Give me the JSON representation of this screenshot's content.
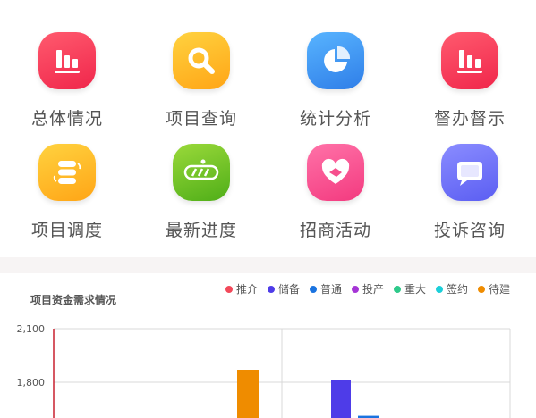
{
  "menu": {
    "items": [
      {
        "label": "总体情况",
        "icon": "bar-chart-icon",
        "color_from": "#ff5a6e",
        "color_to": "#f0264b"
      },
      {
        "label": "项目查询",
        "icon": "search-icon",
        "color_from": "#ffd23f",
        "color_to": "#ffa516"
      },
      {
        "label": "统计分析",
        "icon": "pie-chart-icon",
        "color_from": "#58b4ff",
        "color_to": "#2f7ee8"
      },
      {
        "label": "督办督示",
        "icon": "bar-chart-icon",
        "color_from": "#ff5a6e",
        "color_to": "#f0264b"
      },
      {
        "label": "项目调度",
        "icon": "server-sync-icon",
        "color_from": "#ffd23f",
        "color_to": "#ffa516"
      },
      {
        "label": "最新进度",
        "icon": "progress-bar-icon",
        "color_from": "#9ad93a",
        "color_to": "#4fae18"
      },
      {
        "label": "招商活动",
        "icon": "handshake-heart-icon",
        "color_from": "#ff72a8",
        "color_to": "#f33a7f"
      },
      {
        "label": "投诉咨询",
        "icon": "chat-bubble-icon",
        "color_from": "#8a8cff",
        "color_to": "#5b5ef2"
      }
    ]
  },
  "chart": {
    "title": "项目资金需求情况",
    "legend": [
      {
        "name": "推介",
        "color": "#f2495a"
      },
      {
        "name": "储备",
        "color": "#4e3ce8"
      },
      {
        "name": "普通",
        "color": "#1a73e0"
      },
      {
        "name": "投产",
        "color": "#a535d6"
      },
      {
        "name": "重大",
        "color": "#2ec98a"
      },
      {
        "name": "签约",
        "color": "#1ccfd9"
      },
      {
        "name": "待建",
        "color": "#ef8c00"
      }
    ]
  },
  "chart_data": {
    "type": "bar",
    "title": "项目资金需求情况",
    "y_ticks": [
      "2,100",
      "1,800"
    ],
    "y_tick_values": [
      2100,
      1800
    ],
    "grid": true,
    "legend_position": "top-right",
    "visible_bars": [
      {
        "series": "待建",
        "color": "#ef8c00",
        "value": 1870
      },
      {
        "series": "储备",
        "color": "#4e3ce8",
        "value": 1815
      },
      {
        "series": "普通",
        "color": "#1a73e0",
        "value": 1612
      }
    ]
  }
}
